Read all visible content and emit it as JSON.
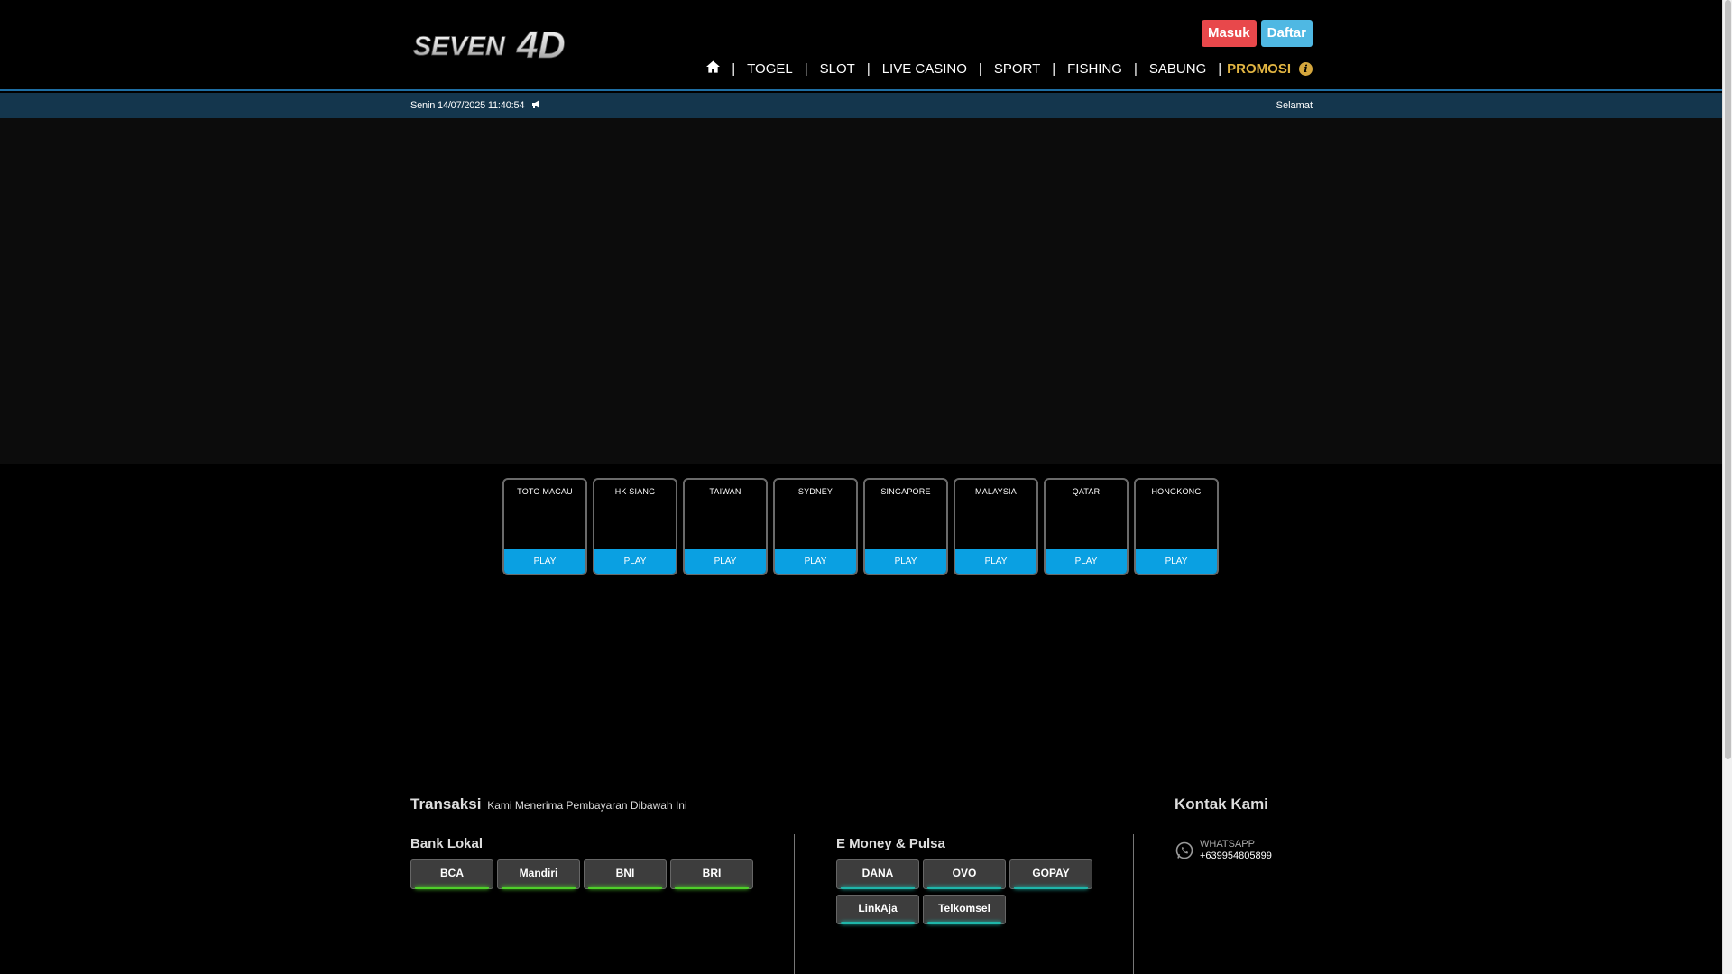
{
  "header": {
    "logo_text": "SEVEN4D",
    "auth": {
      "login": "Masuk",
      "register": "Daftar"
    },
    "nav": {
      "home_icon": "home-icon",
      "items": [
        "TOGEL",
        "SLOT",
        "LIVE CASINO",
        "SPORT",
        "FISHING",
        "SABUNG"
      ],
      "promo": "PROMOSI",
      "separator": "|"
    }
  },
  "statusbar": {
    "datetime": "Senin 14/07/2025 11:40:54",
    "announcement_icon": "megaphone-icon",
    "marquee": "Selamat"
  },
  "lottery": {
    "markets": [
      {
        "name": "TOTO MACAU",
        "action": "PLAY"
      },
      {
        "name": "HK SIANG",
        "action": "PLAY"
      },
      {
        "name": "TAIWAN",
        "action": "PLAY"
      },
      {
        "name": "SYDNEY",
        "action": "PLAY"
      },
      {
        "name": "SINGAPORE",
        "action": "PLAY"
      },
      {
        "name": "MALAYSIA",
        "action": "PLAY"
      },
      {
        "name": "QATAR",
        "action": "PLAY"
      },
      {
        "name": "HONGKONG",
        "action": "PLAY"
      }
    ]
  },
  "footer": {
    "transaksi": {
      "title": "Transaksi",
      "subtitle": "Kami Menerima Pembayaran Dibawah Ini"
    },
    "bank_lokal": {
      "title": "Bank Lokal",
      "items": [
        "BCA",
        "Mandiri",
        "BNI",
        "BRI"
      ]
    },
    "emoney": {
      "title": "E Money & Pulsa",
      "items": [
        "DANA",
        "OVO",
        "GOPAY",
        "LinkAja",
        "Telkomsel"
      ]
    },
    "contact": {
      "title": "Kontak Kami",
      "whatsapp_label": "WHATSAPP",
      "whatsapp_number": "+639954805899"
    }
  },
  "colors": {
    "login_button": "#e8484b",
    "register_button": "#4fb8e3",
    "promo_text": "#e2b542",
    "play_button": "#0aa0e2",
    "status_bar": "#14364d"
  }
}
